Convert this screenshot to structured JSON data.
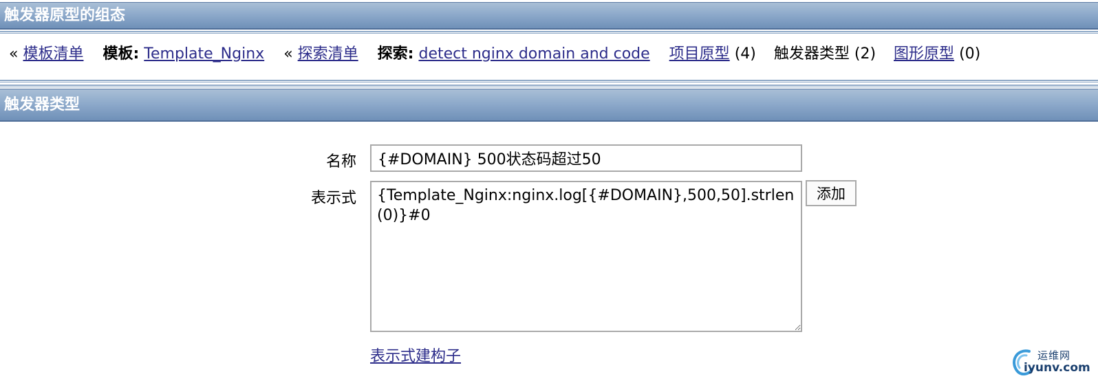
{
  "headers": {
    "top_title": "触发器原型的组态",
    "section_title": "触发器类型"
  },
  "breadcrumb": {
    "back_arrow_1": "«",
    "template_list": "模板清单",
    "template_label": "模板:",
    "template_name": "Template_Nginx",
    "back_arrow_2": "«",
    "discovery_list": "探索清单",
    "discovery_label": "探索:",
    "discovery_name": "detect nginx domain and code",
    "item_prototypes": "项目原型",
    "item_prototypes_count": "(4)",
    "trigger_types": "触发器类型",
    "trigger_types_count": "(2)",
    "graph_prototypes": "图形原型",
    "graph_prototypes_count": "(0)"
  },
  "form": {
    "name_label": "名称",
    "name_value": "{#DOMAIN} 500状态码超过50",
    "expression_label": "表示式",
    "expression_value": "{Template_Nginx:nginx.log[{#DOMAIN},500,50].strlen(0)}#0",
    "add_button": "添加",
    "expression_builder_link": "表示式建构子"
  },
  "watermark": {
    "cn": "运维网",
    "en": "iyunv.com"
  }
}
